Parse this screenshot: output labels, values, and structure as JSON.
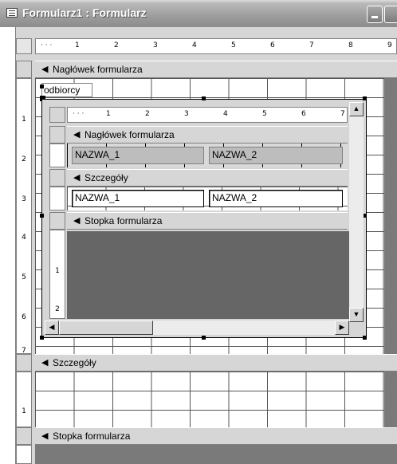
{
  "window": {
    "title": "Formularz1 : Formularz"
  },
  "ruler_main": {
    "labels": [
      "1",
      "2",
      "3",
      "4",
      "5",
      "6",
      "7",
      "8",
      "9"
    ]
  },
  "ruler_sub": {
    "labels": [
      "1",
      "2",
      "3",
      "4",
      "5",
      "6",
      "7"
    ]
  },
  "vruler_main": {
    "labels": [
      "1",
      "2",
      "3",
      "4",
      "5",
      "6",
      "7"
    ]
  },
  "vruler_details": {
    "labels": [
      "1"
    ]
  },
  "vruler_sub": {
    "labels": [
      "1",
      "2"
    ]
  },
  "sections": {
    "header": "Nagłówek formularza",
    "details": "Szczegóły",
    "footer": "Stopka formularza"
  },
  "main_form": {
    "subform_label": "odbiorcy"
  },
  "subform": {
    "header": "Nagłówek formularza",
    "details": "Szczegóły",
    "footer": "Stopka formularza",
    "header_fields": [
      "NAZWA_1",
      "NAZWA_2"
    ],
    "detail_fields": [
      "NAZWA_1",
      "NAZWA_2"
    ]
  },
  "icons": {
    "section_icon": "section-pointer-icon"
  }
}
